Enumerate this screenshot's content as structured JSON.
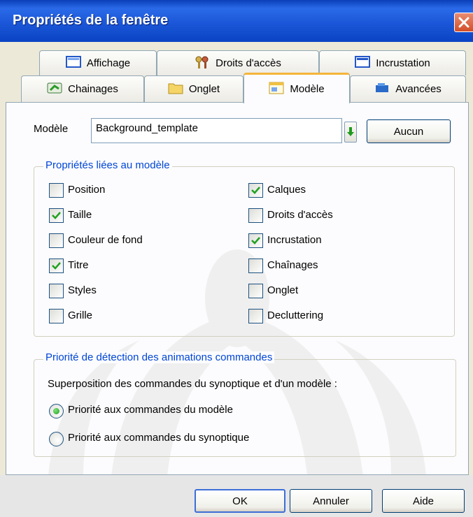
{
  "window": {
    "title": "Propriétés de la fenêtre"
  },
  "tabs": [
    {
      "label": "Affichage",
      "icon": "monitor-icon"
    },
    {
      "label": "Droits d'accès",
      "icon": "keys-icon"
    },
    {
      "label": "Incrustation",
      "icon": "window-icon"
    },
    {
      "label": "Chainages",
      "icon": "chain-icon"
    },
    {
      "label": "Onglet",
      "icon": "folder-icon"
    },
    {
      "label": "Modèle",
      "icon": "template-icon",
      "active": true
    },
    {
      "label": "Avancées",
      "icon": "advanced-icon"
    }
  ],
  "model": {
    "label": "Modèle",
    "value": "Background_template",
    "none_button": "Aucun"
  },
  "linked_properties": {
    "title": "Propriétés liées au modèle",
    "left": [
      {
        "label": "Position",
        "checked": false
      },
      {
        "label": "Taille",
        "checked": true
      },
      {
        "label": "Couleur de fond",
        "checked": false
      },
      {
        "label": "Titre",
        "checked": true
      },
      {
        "label": "Styles",
        "checked": false
      },
      {
        "label": "Grille",
        "checked": false
      }
    ],
    "right": [
      {
        "label": "Calques",
        "checked": true
      },
      {
        "label": "Droits d'accès",
        "checked": false
      },
      {
        "label": "Incrustation",
        "checked": true
      },
      {
        "label": "Chaînages",
        "checked": false
      },
      {
        "label": "Onglet",
        "checked": false
      },
      {
        "label": "Decluttering",
        "checked": false
      }
    ]
  },
  "priority": {
    "title": "Priorité de détection des animations commandes",
    "description": "Superposition des commandes du synoptique et d'un modèle :",
    "options": [
      {
        "label": "Priorité aux commandes du modèle",
        "selected": true
      },
      {
        "label": "Priorité aux commandes du synoptique",
        "selected": false
      }
    ]
  },
  "buttons": {
    "ok": "OK",
    "cancel": "Annuler",
    "help": "Aide"
  },
  "colors": {
    "titlebar": "#2a6ae8",
    "active_tab_accent": "#f5b53a",
    "group_title": "#0046d5",
    "check_green": "#21a121"
  }
}
